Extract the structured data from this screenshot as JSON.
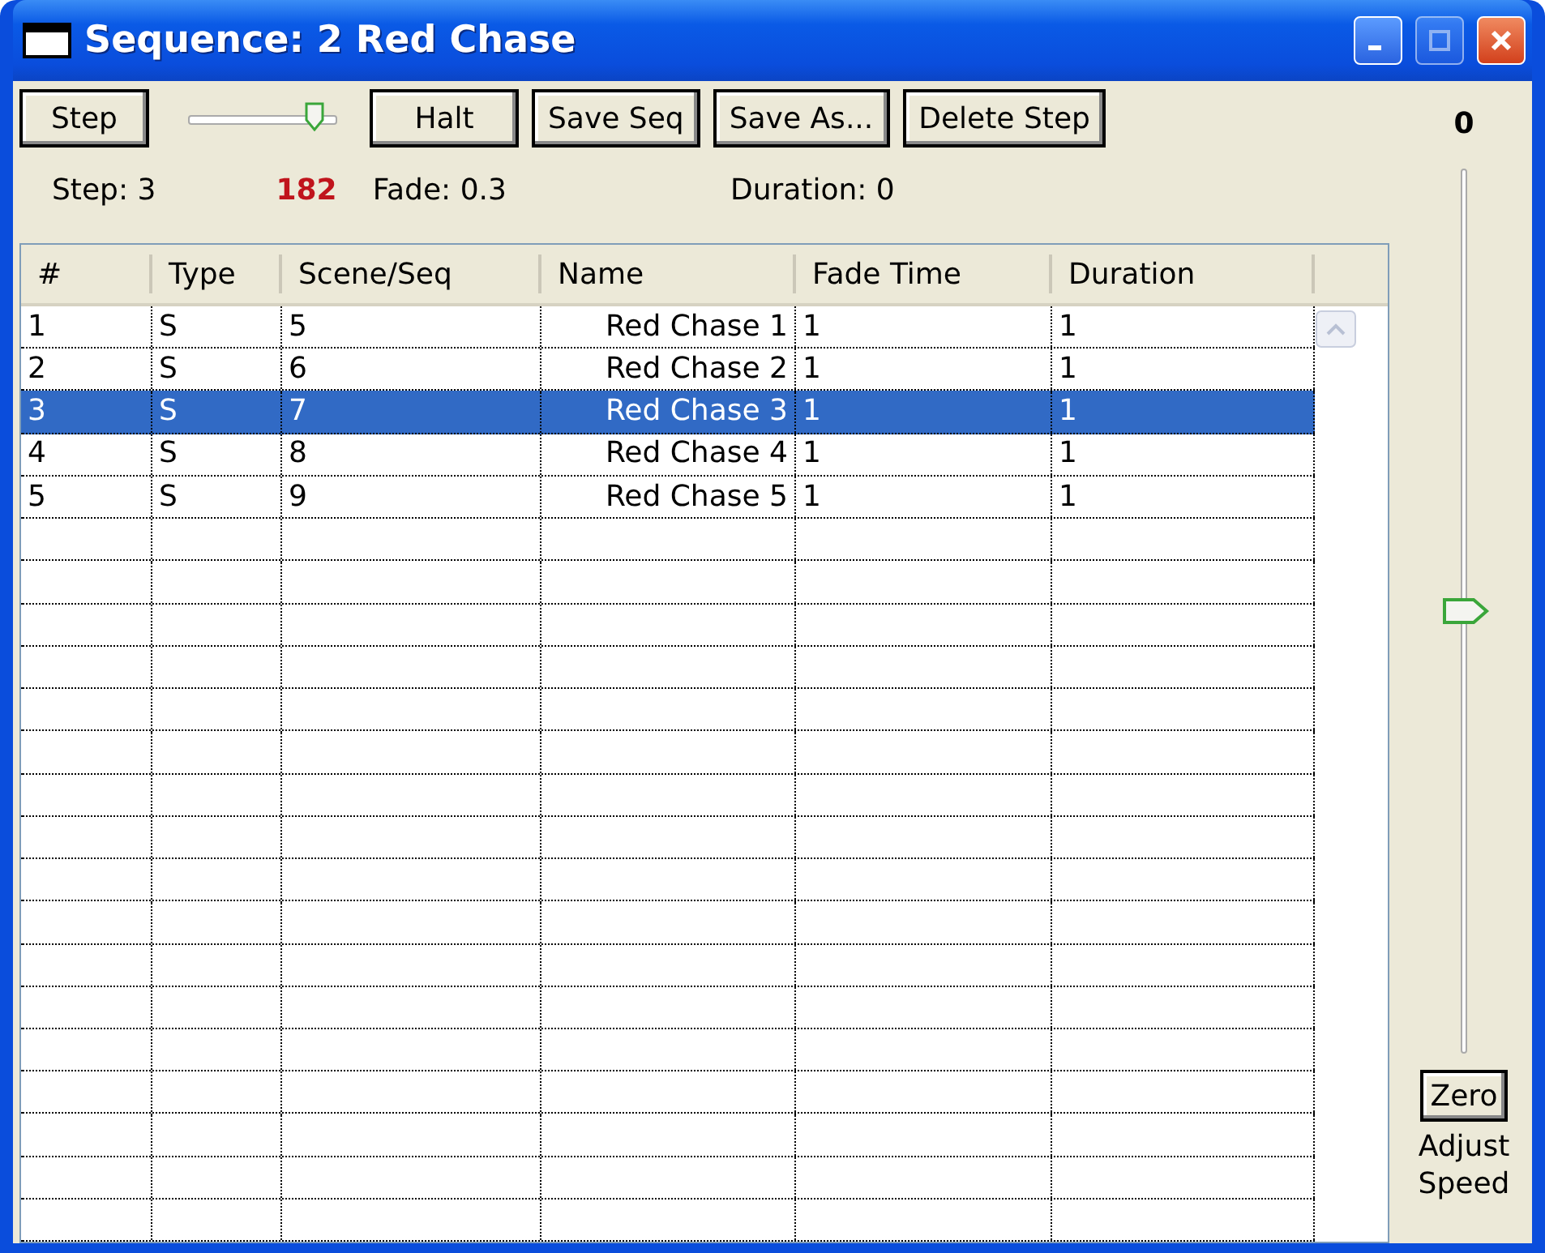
{
  "window": {
    "title": "Sequence: 2 Red Chase",
    "maximize_disabled": true
  },
  "toolbar": {
    "buttons": [
      "Step",
      "Halt",
      "Save Seq",
      "Save As...",
      "Delete Step"
    ],
    "step_slider": {
      "level": 0.85
    }
  },
  "status": {
    "step": "Step: 3",
    "counter": "182",
    "fade": "Fade: 0.3",
    "duration": "Duration: 0"
  },
  "table": {
    "columns": [
      "#",
      "Type",
      "Scene/Seq",
      "Name",
      "Fade Time",
      "Duration"
    ],
    "rows": [
      {
        "cells": [
          "1",
          "S",
          "5",
          "Red Chase 1",
          "1",
          "1"
        ],
        "selected": false
      },
      {
        "cells": [
          "2",
          "S",
          "6",
          "Red Chase 2",
          "1",
          "1"
        ],
        "selected": false
      },
      {
        "cells": [
          "3",
          "S",
          "7",
          "Red Chase 3",
          "1",
          "1"
        ],
        "selected": true
      },
      {
        "cells": [
          "4",
          "S",
          "8",
          "Red Chase 4",
          "1",
          "1"
        ],
        "selected": false
      },
      {
        "cells": [
          "5",
          "S",
          "9",
          "Red Chase 5",
          "1",
          "1"
        ],
        "selected": false
      }
    ]
  },
  "speed": {
    "reading": "0",
    "level": 0.5,
    "zero_button": "Zero",
    "label": "Adjust Speed"
  }
}
